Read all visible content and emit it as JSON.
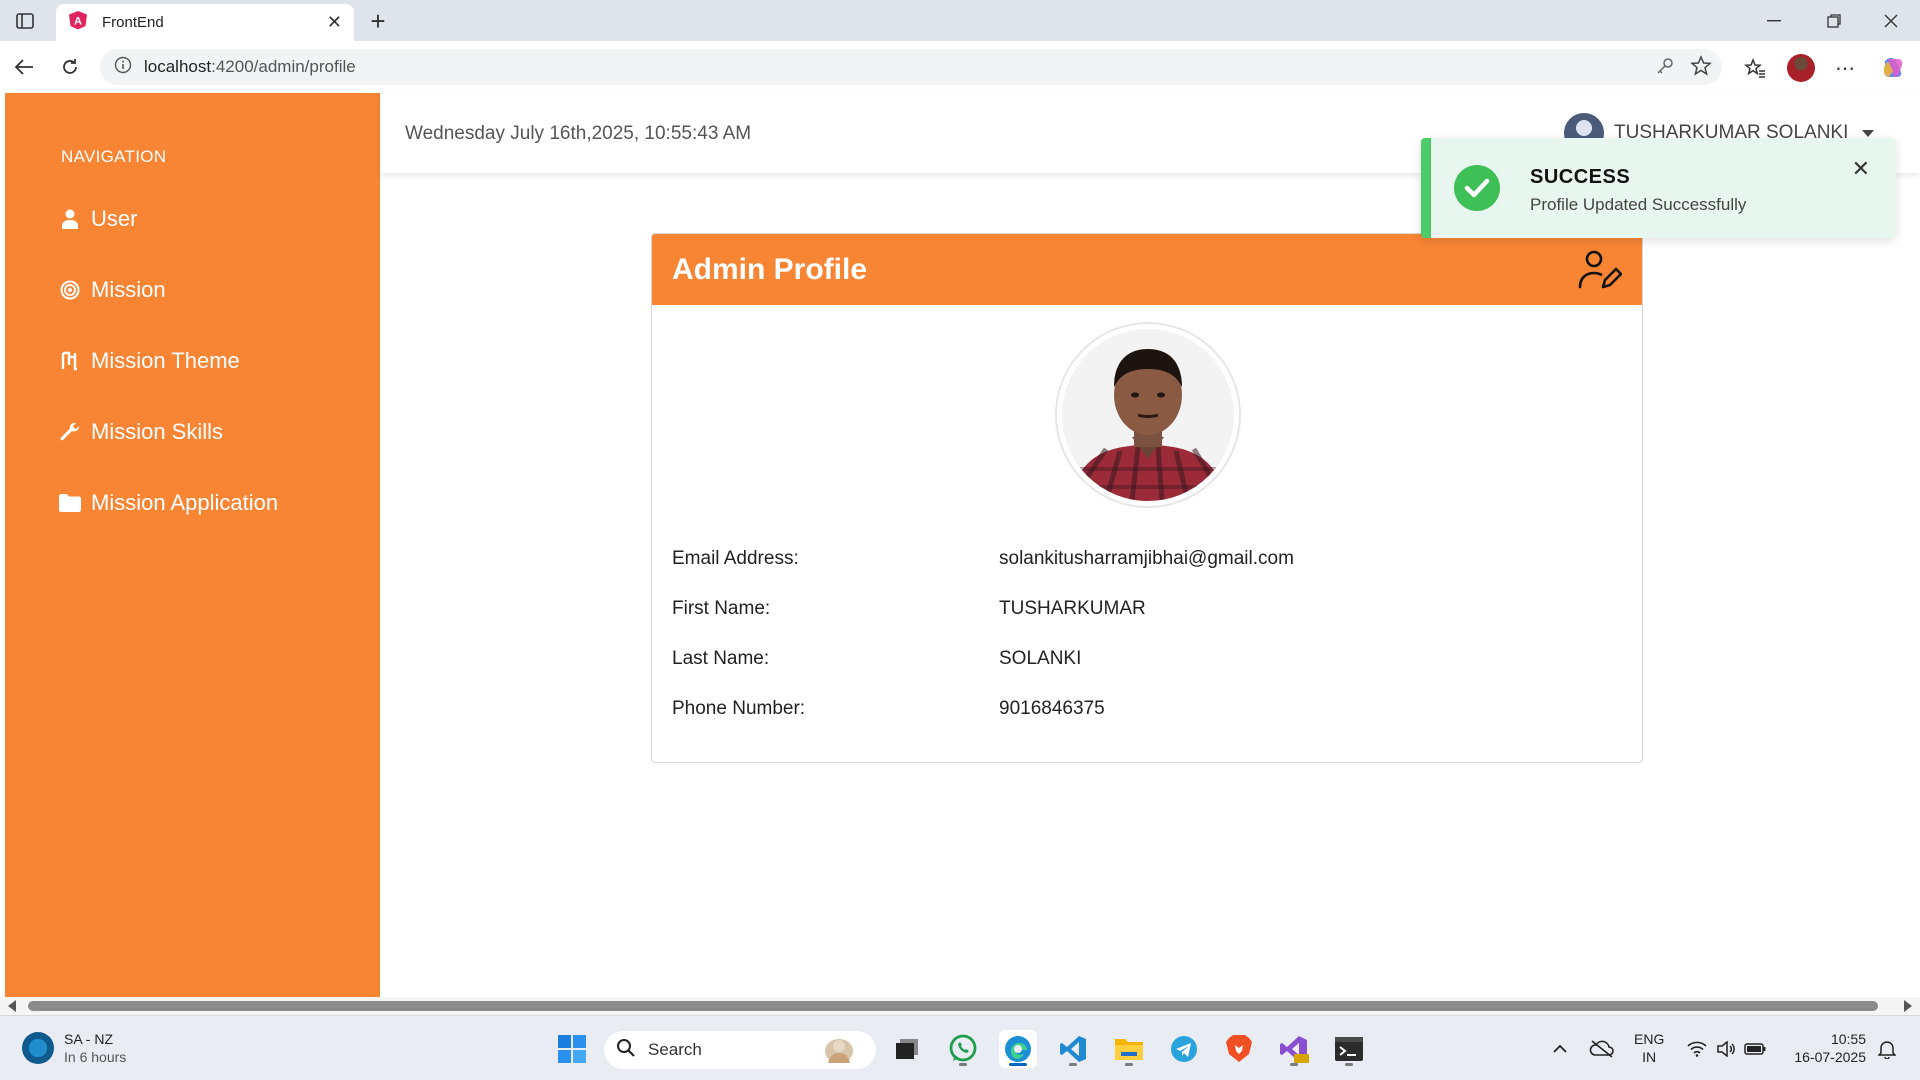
{
  "browser": {
    "tab_title": "FrontEnd",
    "url_host": "localhost",
    "url_path": ":4200/admin/profile"
  },
  "sidebar": {
    "heading": "NAVIGATION",
    "items": [
      {
        "label": "User",
        "icon": "user-icon"
      },
      {
        "label": "Mission",
        "icon": "target-icon"
      },
      {
        "label": "Mission Theme",
        "icon": "theme-icon"
      },
      {
        "label": "Mission Skills",
        "icon": "wrench-icon"
      },
      {
        "label": "Mission Application",
        "icon": "folder-icon"
      }
    ]
  },
  "header": {
    "datetime": "Wednesday July 16th,2025, 10:55:43 AM",
    "user_name": "TUSHARKUMAR SOLANKI"
  },
  "profile": {
    "title": "Admin Profile",
    "fields": [
      {
        "label": "Email Address:",
        "value": "solankitusharramjibhai@gmail.com"
      },
      {
        "label": "First Name:",
        "value": "TUSHARKUMAR"
      },
      {
        "label": "Last Name:",
        "value": "SOLANKI"
      },
      {
        "label": "Phone Number:",
        "value": "9016846375"
      }
    ]
  },
  "toast": {
    "title": "SUCCESS",
    "message": "Profile Updated Successfully"
  },
  "taskbar": {
    "weather_title": "SA - NZ",
    "weather_sub": "In 6 hours",
    "search_label": "Search",
    "lang_top": "ENG",
    "lang_bottom": "IN",
    "time": "10:55",
    "date": "16-07-2025"
  },
  "colors": {
    "accent": "#f88533",
    "toast_bg": "#e7f6ee",
    "toast_border": "#4ccb6a"
  }
}
